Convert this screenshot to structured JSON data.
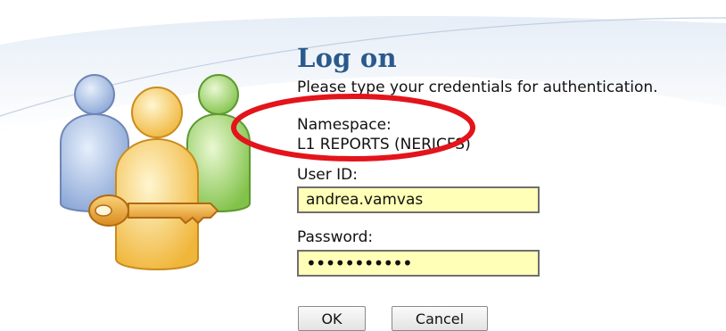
{
  "login": {
    "title": "Log on",
    "subtitle": "Please type your credentials for authentication.",
    "namespace_label": "Namespace:",
    "namespace_value": "L1 REPORTS (NERICFS)",
    "userid_label": "User ID:",
    "userid_value": "andrea.vamvas",
    "password_label": "Password:",
    "password_value": "•••••••••••",
    "ok_label": "OK",
    "cancel_label": "Cancel"
  },
  "colors": {
    "title": "#2a5a8c",
    "field_background": "#ffffb7",
    "highlight_ring": "#e3141b"
  },
  "icons": {
    "logo": "users-key-icon",
    "highlight": "red-highlight-ellipse"
  }
}
